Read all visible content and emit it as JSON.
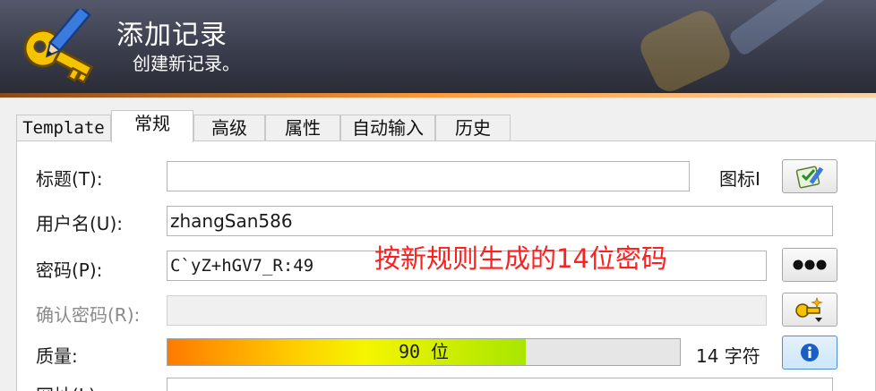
{
  "banner": {
    "title": "添加记录",
    "subtitle": "创建新记录。",
    "icon": "key-pencil-icon"
  },
  "tabs": [
    {
      "label": "Template",
      "active": false
    },
    {
      "label": "常规",
      "active": true
    },
    {
      "label": "高级",
      "active": false
    },
    {
      "label": "属性",
      "active": false
    },
    {
      "label": "自动输入",
      "active": false
    },
    {
      "label": "历史",
      "active": false
    }
  ],
  "form": {
    "title": {
      "label": "标题(T):",
      "value": ""
    },
    "icon_label": "图标I",
    "username": {
      "label": "用户名(U):",
      "value": "zhangSan586"
    },
    "password": {
      "label": "密码(P):",
      "value": "C`yZ+hGV7_R:49"
    },
    "repeat_password": {
      "label": "确认密码(R):",
      "value": ""
    },
    "quality": {
      "label": "质量:",
      "bar_text": "90 位",
      "fraction": 0.7,
      "char_count": "14 字符"
    },
    "url": {
      "label": "网址(L):"
    }
  },
  "annotation": "按新规则生成的14位密码",
  "colors": {
    "banner": "#3a3d4c",
    "accent_line": "#ff9a3a",
    "annotation": "#ff1f1f"
  }
}
